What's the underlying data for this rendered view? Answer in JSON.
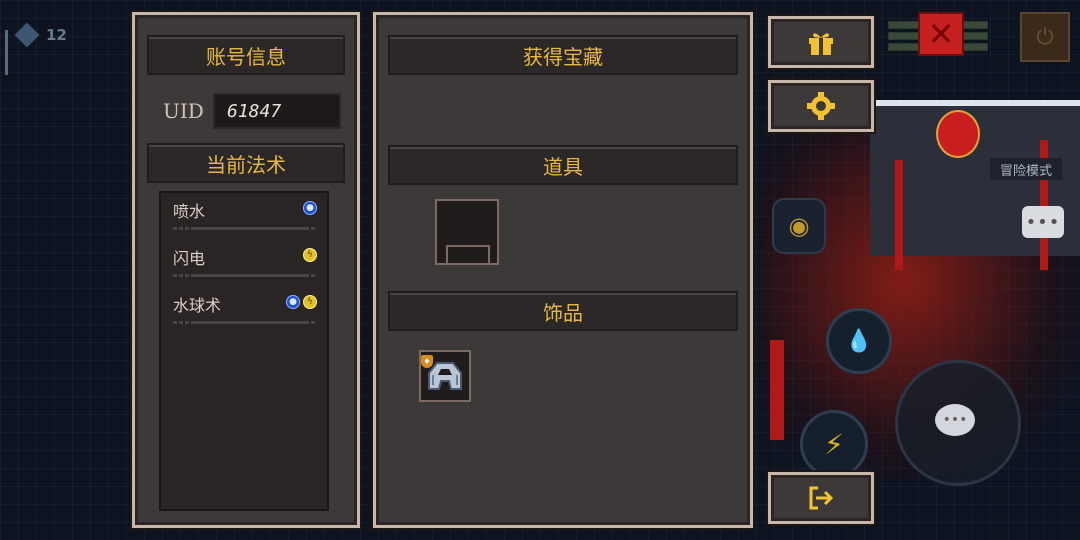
{
  "hud": {
    "gem_count": "12",
    "mode_label": "冒险模式"
  },
  "account_panel": {
    "title": "账号信息",
    "uid_label": "UID",
    "uid_value": "61847",
    "spells_title": "当前法术",
    "spells": [
      {
        "name": "喷水",
        "elements": [
          "water-icon"
        ]
      },
      {
        "name": "闪电",
        "elements": [
          "lightning-icon"
        ]
      },
      {
        "name": "水球术",
        "elements": [
          "water-icon",
          "lightning-icon"
        ]
      }
    ]
  },
  "treasure_panel": {
    "title": "获得宝藏",
    "props_title": "道具",
    "accessories_title": "饰品"
  },
  "side_buttons": {
    "gift": "gift-icon",
    "settings": "gear-icon",
    "exit": "exit-icon"
  },
  "colors": {
    "header_text": "#e8b840",
    "panel_bg": "#3d3938",
    "panel_border": "#c9b8a8",
    "water": "#1c4fd6",
    "lightning": "#e2c020"
  }
}
